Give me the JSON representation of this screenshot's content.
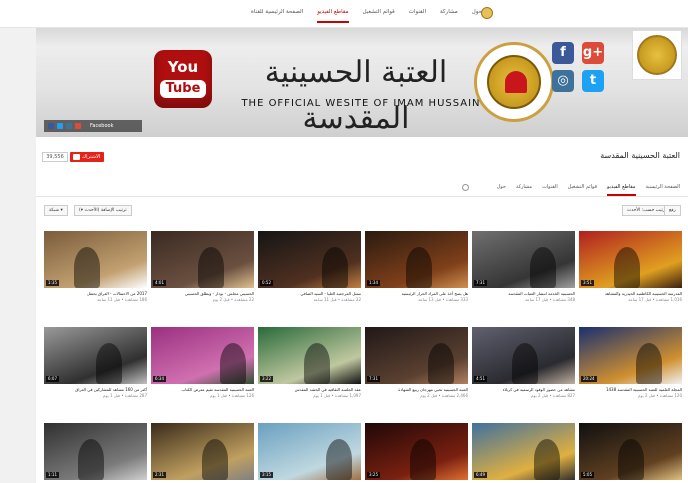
{
  "topnav": {
    "links": [
      "حول",
      "مشاركة",
      "القنوات",
      "قوائم التشغيل",
      "مقاطع الفيديو",
      "الصفحة الرئيسية للقناة"
    ],
    "active_index": 4
  },
  "banner": {
    "youtube_you": "You",
    "youtube_tube": "Tube",
    "calligraphy": "العتبة الحسينية المقدسة",
    "official_text": "THE OFFICIAL WESITE OF IMAM HUSSAIN",
    "links_label": "Facebook",
    "social": {
      "fb": "f",
      "gp": "g+",
      "ig": "◎",
      "tw": "t"
    }
  },
  "channel": {
    "name": "العتبة الحسينية المقدسة",
    "subscribe_label": "الاشتراك",
    "subscriber_count": "39,556"
  },
  "tabs": {
    "items": [
      "الصفحة الرئيسية",
      "مقاطع الفيديو",
      "قوائم التشغيل",
      "القنوات",
      "مشاركة",
      "حول"
    ],
    "active_index": 1
  },
  "toolbar": {
    "left_btn": "تنزيل",
    "sort_btn": "ترتيب حسب: الأحدث ▾",
    "view_btn": "شبكة ▾",
    "filter_btn": "ترتيب الإضافة (الأحدث ▾)",
    "right_btn": "رفع"
  },
  "videos": [
    {
      "duration": "1:35",
      "title": "2017 من الاحتفالات - العراق يحتفل",
      "meta": "186 مشاهدة • قبل 11 ساعة"
    },
    {
      "duration": "4:01",
      "title": "الحسيني مجلس - بوذار - ويطلق الحسيني",
      "meta": "22 مشاهدة • قبل 2 يوم"
    },
    {
      "duration": "0:52",
      "title": "ممثل المرجعية العليا - السيد الصافي",
      "meta": "22 مشاهدة • قبل 11 ساعة"
    },
    {
      "duration": "1:34",
      "title": "هل يصح أخذ على المراد الحراز الرئيسية",
      "meta": "333 مشاهدة • قبل 13 ساعة"
    },
    {
      "duration": "7:31",
      "title": "الحسينية الخدمة انتشار العتبات المقدسة",
      "meta": "348 مشاهدة • قبل 17 ساعة"
    },
    {
      "duration": "3:51",
      "title": "المدرسة الحسينية الكاظمية الحيدرية والمشاهد",
      "meta": "1,016 مشاهدة • قبل 17 ساعة"
    },
    {
      "duration": "6:07",
      "title": "أكثر من 160 مشاهد للمشاركين في العراق",
      "meta": "287 مشاهدة • قبل 1 يوم"
    },
    {
      "duration": "6:34",
      "title": "العتبة الحسينية المقدسة تقيم معرض الكتاب",
      "meta": "126 مشاهدة • قبل 1 يوم"
    },
    {
      "duration": "3:22",
      "title": "عقد الجلسة الثقافية في الحشد المقدس",
      "meta": "1,097 مشاهدة • قبل 1 يوم"
    },
    {
      "duration": "7:31",
      "title": "العتبة الحسينية تحيي مهرجان ربيع الشهادة",
      "meta": "2,466 مشاهدة • قبل 2 يوم"
    },
    {
      "duration": "4:51",
      "title": "مشاهد من حضور الوفود الرسمية في كربلاء",
      "meta": "827 مشاهدة • قبل 2 يوم"
    },
    {
      "duration": "20:24",
      "title": "المجلة العلمية للعتبة الحسينية المقدسة 1438",
      "meta": "120 مشاهدة • قبل 2 يوم"
    },
    {
      "duration": "1:11",
      "title": "",
      "meta": ""
    },
    {
      "duration": "2:31",
      "title": "",
      "meta": ""
    },
    {
      "duration": "3:15",
      "title": "",
      "meta": ""
    },
    {
      "duration": "3:25",
      "title": "",
      "meta": ""
    },
    {
      "duration": "6:49",
      "title": "",
      "meta": ""
    },
    {
      "duration": "5:05",
      "title": "",
      "meta": ""
    }
  ],
  "colors": {
    "accent": "#cc0000",
    "subscribe": "#e62117"
  }
}
